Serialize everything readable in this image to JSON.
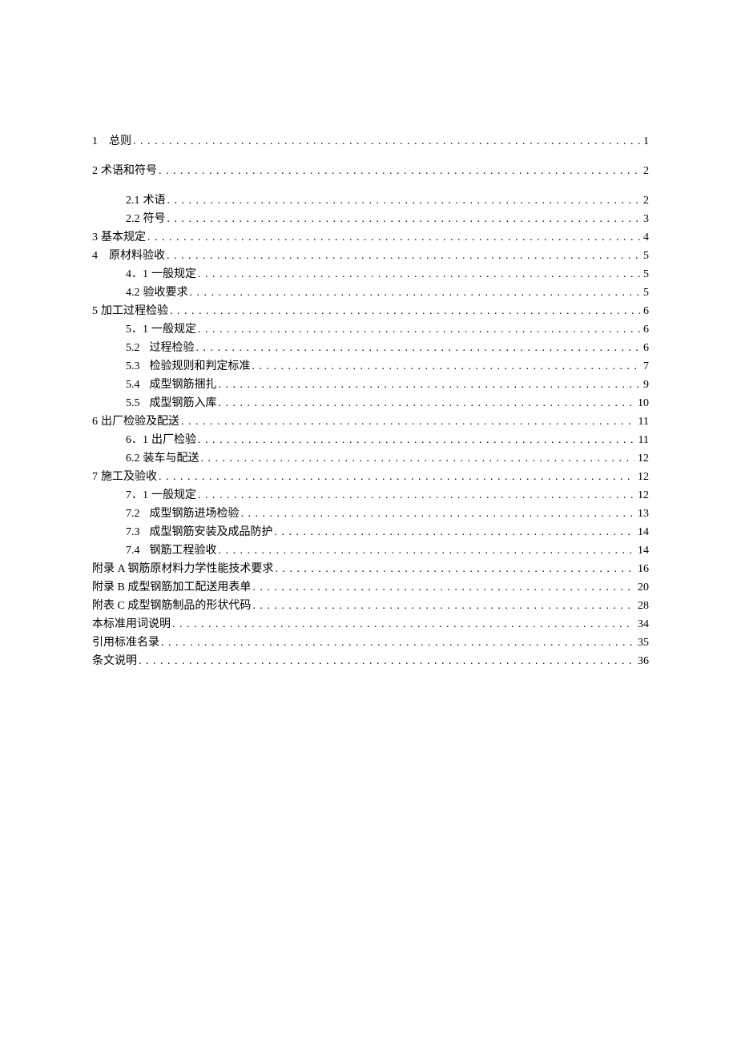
{
  "toc": [
    {
      "indent": 0,
      "spaced": false,
      "num": "1",
      "title": "总则",
      "page": "1",
      "numClass": "ch-num"
    },
    {
      "indent": 0,
      "spaced": true,
      "num": "2",
      "title": "术语和符号",
      "page": "2",
      "numClass": "ch-num-tight"
    },
    {
      "indent": 1,
      "spaced": true,
      "num": "2.1",
      "title": "术语",
      "page": "2",
      "numClass": "ch-num-tight"
    },
    {
      "indent": 1,
      "spaced": false,
      "num": "2.2",
      "title": "符号",
      "page": "3",
      "numClass": "ch-num-tight"
    },
    {
      "indent": 0,
      "spaced": false,
      "num": "3",
      "title": "基本规定",
      "page": "4",
      "numClass": "ch-num-tight"
    },
    {
      "indent": 0,
      "spaced": false,
      "num": "4",
      "title": "原材料验收",
      "page": "5",
      "numClass": "ch-num"
    },
    {
      "indent": 1,
      "spaced": false,
      "num": "4．1",
      "title": "一般规定",
      "page": "5",
      "numClass": "ch-num-tight"
    },
    {
      "indent": 1,
      "spaced": false,
      "num": "4.2",
      "title": "验收要求",
      "page": "5",
      "numClass": "ch-num-tight"
    },
    {
      "indent": 0,
      "spaced": false,
      "num": "5",
      "title": "加工过程检验",
      "page": "6",
      "numClass": "ch-num-tight"
    },
    {
      "indent": 1,
      "spaced": false,
      "num": "5．1",
      "title": "一般规定",
      "page": "6",
      "numClass": "ch-num-tight"
    },
    {
      "indent": 1,
      "spaced": false,
      "num": "5.2",
      "title": "过程检验",
      "page": "6",
      "numClass": "num-pad"
    },
    {
      "indent": 1,
      "spaced": false,
      "num": "5.3",
      "title": "检验规则和判定标准",
      "page": "7",
      "numClass": "num-pad"
    },
    {
      "indent": 1,
      "spaced": false,
      "num": "5.4",
      "title": "成型钢筋捆扎",
      "page": "9",
      "numClass": "num-pad"
    },
    {
      "indent": 1,
      "spaced": false,
      "num": "5.5",
      "title": "成型钢筋入库",
      "page": "10",
      "numClass": "num-pad"
    },
    {
      "indent": 0,
      "spaced": false,
      "num": "6",
      "title": "出厂检验及配送",
      "page": "11",
      "numClass": "ch-num-tight"
    },
    {
      "indent": 1,
      "spaced": false,
      "num": "6．1",
      "title": "出厂检验",
      "page": "11",
      "numClass": "ch-num-tight"
    },
    {
      "indent": 1,
      "spaced": false,
      "num": "6.2",
      "title": "装车与配送",
      "page": "12",
      "numClass": "ch-num-tight"
    },
    {
      "indent": 0,
      "spaced": false,
      "num": "7",
      "title": "施工及验收",
      "page": "12",
      "numClass": "ch-num-tight"
    },
    {
      "indent": 1,
      "spaced": false,
      "num": "7．1",
      "title": "一般规定",
      "page": "12",
      "numClass": "ch-num-tight"
    },
    {
      "indent": 1,
      "spaced": false,
      "num": "7.2",
      "title": "成型钢筋进场检验",
      "page": "13",
      "numClass": "num-pad"
    },
    {
      "indent": 1,
      "spaced": false,
      "num": "7.3",
      "title": "成型钢筋安装及成品防护",
      "page": "14",
      "numClass": "num-pad"
    },
    {
      "indent": 1,
      "spaced": false,
      "num": "7.4",
      "title": "钢筋工程验收",
      "page": "14",
      "numClass": "num-pad"
    },
    {
      "indent": 0,
      "spaced": false,
      "num": "",
      "title": "附录 A 钢筋原材料力学性能技术要求",
      "page": "16",
      "numClass": ""
    },
    {
      "indent": 0,
      "spaced": false,
      "num": "",
      "title": "附录 B 成型钢筋加工配送用表单",
      "page": "20",
      "numClass": ""
    },
    {
      "indent": 0,
      "spaced": false,
      "num": "",
      "title": "附表 C 成型钢筋制品的形状代码",
      "page": "28",
      "numClass": ""
    },
    {
      "indent": 0,
      "spaced": false,
      "num": "",
      "title": "本标准用词说明",
      "page": "34",
      "numClass": ""
    },
    {
      "indent": 0,
      "spaced": false,
      "num": "",
      "title": "引用标准名录",
      "page": "35",
      "numClass": ""
    },
    {
      "indent": 0,
      "spaced": false,
      "num": "",
      "title": "条文说明",
      "page": "36",
      "numClass": ""
    }
  ]
}
